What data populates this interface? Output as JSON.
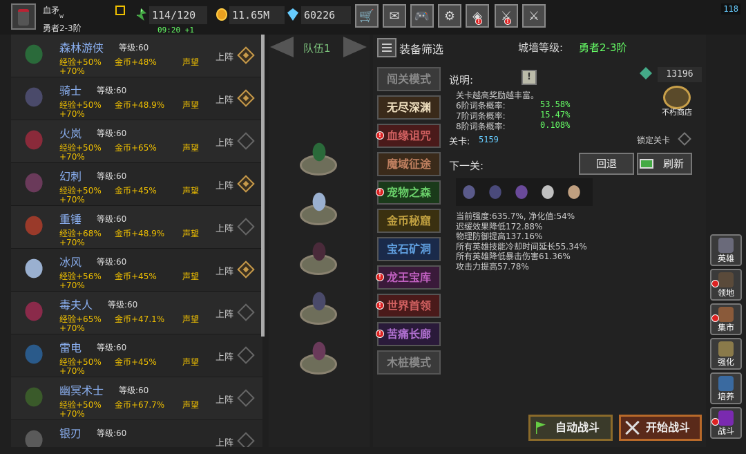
{
  "player": {
    "name": "血矛",
    "tag": "w",
    "rank": "勇者2-3阶"
  },
  "resources": {
    "energy": "114/120",
    "energy_timer": "09:20 +1",
    "gold": "11.65M",
    "gems": "60226"
  },
  "top_menu": [
    {
      "icon": "shop-cart-icon",
      "glyph": "🛒"
    },
    {
      "icon": "mail-icon",
      "glyph": "✉"
    },
    {
      "icon": "gamepad-icon",
      "glyph": "🎮"
    },
    {
      "icon": "settings-gear-icon",
      "glyph": "⚙"
    },
    {
      "icon": "rainbow-shield-icon",
      "glyph": "◈"
    },
    {
      "icon": "crossed-weapons-icon",
      "glyph": "⚔"
    },
    {
      "icon": "sword-crossed-icon",
      "glyph": "⚔"
    }
  ],
  "fps": "118",
  "heroes": [
    {
      "name": "森林游侠",
      "level": "等级:60",
      "exp": "经验+50%",
      "gold": "金币+48%",
      "fame": "声望",
      "fame_bonus": "+70%",
      "deploy": "上阵",
      "deployed": true,
      "color": "#2a6a3a"
    },
    {
      "name": "骑士",
      "level": "等级:60",
      "exp": "经验+50%",
      "gold": "金币+48.9%",
      "fame": "声望",
      "fame_bonus": "+70%",
      "deploy": "上阵",
      "deployed": true,
      "color": "#4a4a6a"
    },
    {
      "name": "火岚",
      "level": "等级:60",
      "exp": "经验+50%",
      "gold": "金币+65%",
      "fame": "声望",
      "fame_bonus": "+70%",
      "deploy": "上阵",
      "deployed": false,
      "color": "#8a2a3a"
    },
    {
      "name": "幻刺",
      "level": "等级:60",
      "exp": "经验+50%",
      "gold": "金币+45%",
      "fame": "声望",
      "fame_bonus": "+70%",
      "deploy": "上阵",
      "deployed": true,
      "color": "#6a3a5a"
    },
    {
      "name": "重锤",
      "level": "等级:60",
      "exp": "经验+68%",
      "gold": "金币+48.9%",
      "fame": "声望",
      "fame_bonus": "+70%",
      "deploy": "上阵",
      "deployed": false,
      "color": "#9a3a2a"
    },
    {
      "name": "冰风",
      "level": "等级:60",
      "exp": "经验+56%",
      "gold": "金币+45%",
      "fame": "声望",
      "fame_bonus": "+70%",
      "deploy": "上阵",
      "deployed": true,
      "color": "#9ab0d0"
    },
    {
      "name": "毒夫人",
      "level": "等级:60",
      "exp": "经验+65%",
      "gold": "金币+47.1%",
      "fame": "声望",
      "fame_bonus": "+70%",
      "deploy": "上阵",
      "deployed": false,
      "color": "#8a2a4a"
    },
    {
      "name": "雷电",
      "level": "等级:60",
      "exp": "经验+50%",
      "gold": "金币+45%",
      "fame": "声望",
      "fame_bonus": "+70%",
      "deploy": "上阵",
      "deployed": false,
      "color": "#2a5a8a"
    },
    {
      "name": "幽冥术士",
      "level": "等级:60",
      "exp": "经验+50%",
      "gold": "金币+67.7%",
      "fame": "声望",
      "fame_bonus": "+70%",
      "deploy": "上阵",
      "deployed": false,
      "color": "#3a5a2a"
    },
    {
      "name": "银刃",
      "level": "等级:60",
      "exp": "",
      "gold": "",
      "fame": "",
      "fame_bonus": "",
      "deploy": "上阵",
      "deployed": false,
      "color": "#5a5a5a"
    }
  ],
  "team": {
    "label": "队伍1",
    "members": [
      "#2a6a3a",
      "#9ab0d0",
      "#4a2a3a",
      "#4a4a6a",
      "#6a3a5a"
    ]
  },
  "filter": {
    "label": "装备筛选",
    "wall_label": "城墙等级:",
    "wall_value": "勇者2-3阶"
  },
  "modes": [
    {
      "label": "闯关模式",
      "text_color": "#8a8a8a",
      "bg": "#3a3a3a",
      "alert": false
    },
    {
      "label": "无尽深渊",
      "text_color": "#f0e0c0",
      "bg": "#3a2a1a",
      "alert": false
    },
    {
      "label": "血缘诅咒",
      "text_color": "#d06060",
      "bg": "#4a1a1a",
      "alert": true
    },
    {
      "label": "魔域征途",
      "text_color": "#c08060",
      "bg": "#3a2a1a",
      "alert": false
    },
    {
      "label": "宠物之森",
      "text_color": "#6ad06a",
      "bg": "#1a3a1a",
      "alert": true
    },
    {
      "label": "金币秘窟",
      "text_color": "#c0a040",
      "bg": "#3a3010",
      "alert": false
    },
    {
      "label": "宝石矿洞",
      "text_color": "#60a0e0",
      "bg": "#1a2a4a",
      "alert": false
    },
    {
      "label": "龙王宝库",
      "text_color": "#c060c0",
      "bg": "#3a1a3a",
      "alert": true
    },
    {
      "label": "世界首领",
      "text_color": "#d06060",
      "bg": "#4a1a1a",
      "alert": true
    },
    {
      "label": "苦痛长廊",
      "text_color": "#b070d0",
      "bg": "#2a1a3a",
      "alert": true
    },
    {
      "label": "木桩模式",
      "text_color": "#8a8a8a",
      "bg": "#3a3a3a",
      "alert": false
    }
  ],
  "details": {
    "desc_label": "说明:",
    "info_glyph": "!",
    "desc_line": "关卡越高奖励越丰富。",
    "tiers": [
      {
        "label": "6阶词条概率:",
        "value": "53.58%"
      },
      {
        "label": "7阶词条概率:",
        "value": "15.47%"
      },
      {
        "label": "8阶词条概率:",
        "value": "0.108%"
      }
    ],
    "tokens": "13196",
    "shop_label": "不朽商店",
    "stage_label": "关卡:",
    "stage_value": "5159",
    "lock_label": "锁定关卡",
    "next_label": "下一关:",
    "back_label": "回退",
    "refresh_label": "刷新",
    "enemies": [
      "#5a5a8a",
      "#4a4a7a",
      "#6a4a9a",
      "#c0c0c0",
      "#c0a080"
    ],
    "effects": [
      "当前强度:635.7%, 净化值:54%",
      "迟缓效果降低172.88%",
      "物理防御提高137.16%",
      "所有英雄技能冷却时间延长55.34%",
      "所有英雄降低暴击伤害61.36%",
      "攻击力提高57.78%"
    ],
    "auto_battle": "自动战斗",
    "start_battle": "开始战斗"
  },
  "side_nav": [
    {
      "label": "英雄",
      "icon": "hero-helmet-icon",
      "color": "#6a6a7a",
      "alert": false
    },
    {
      "label": "领地",
      "icon": "territory-castle-icon",
      "color": "#5a4a3a",
      "alert": true
    },
    {
      "label": "集市",
      "icon": "market-stall-icon",
      "color": "#8a5a3a",
      "alert": true
    },
    {
      "label": "强化",
      "icon": "enhance-anvil-icon",
      "color": "#8a7a4a",
      "alert": false
    },
    {
      "label": "培养",
      "icon": "train-potion-icon",
      "color": "#3a6aa0",
      "alert": false
    },
    {
      "label": "战斗",
      "icon": "battle-portal-icon",
      "color": "#7a2ab0",
      "alert": true
    }
  ]
}
